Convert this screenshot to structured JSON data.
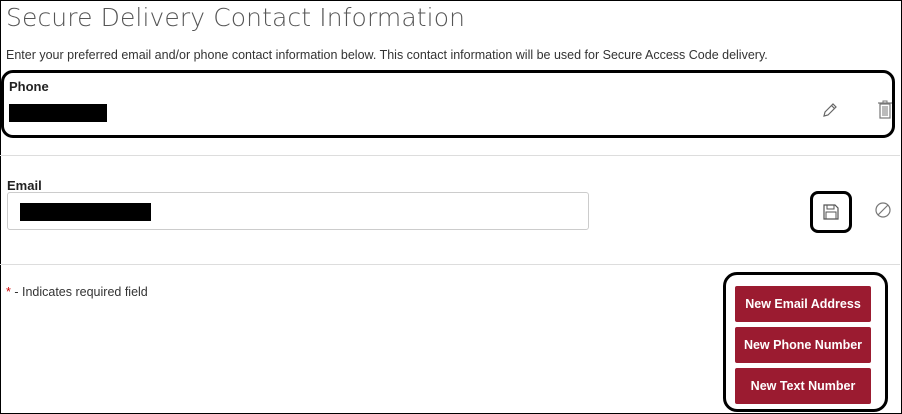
{
  "page": {
    "title": "Secure Delivery Contact Information",
    "intro": "Enter your preferred email and/or phone contact information below. This contact information will be used for Secure Access Code delivery."
  },
  "phone": {
    "label": "Phone",
    "edit_icon": "pencil-icon",
    "delete_icon": "trash-icon"
  },
  "email": {
    "label": "Email",
    "save_icon": "save-icon",
    "cancel_icon": "cancel-icon"
  },
  "required_note": {
    "star": "*",
    "text": " - Indicates required field"
  },
  "actions": {
    "new_email": "New Email Address",
    "new_phone": "New Phone Number",
    "new_text": "New Text Number"
  },
  "colors": {
    "button_bg": "#9b1b30",
    "required_star": "#cc0000"
  }
}
